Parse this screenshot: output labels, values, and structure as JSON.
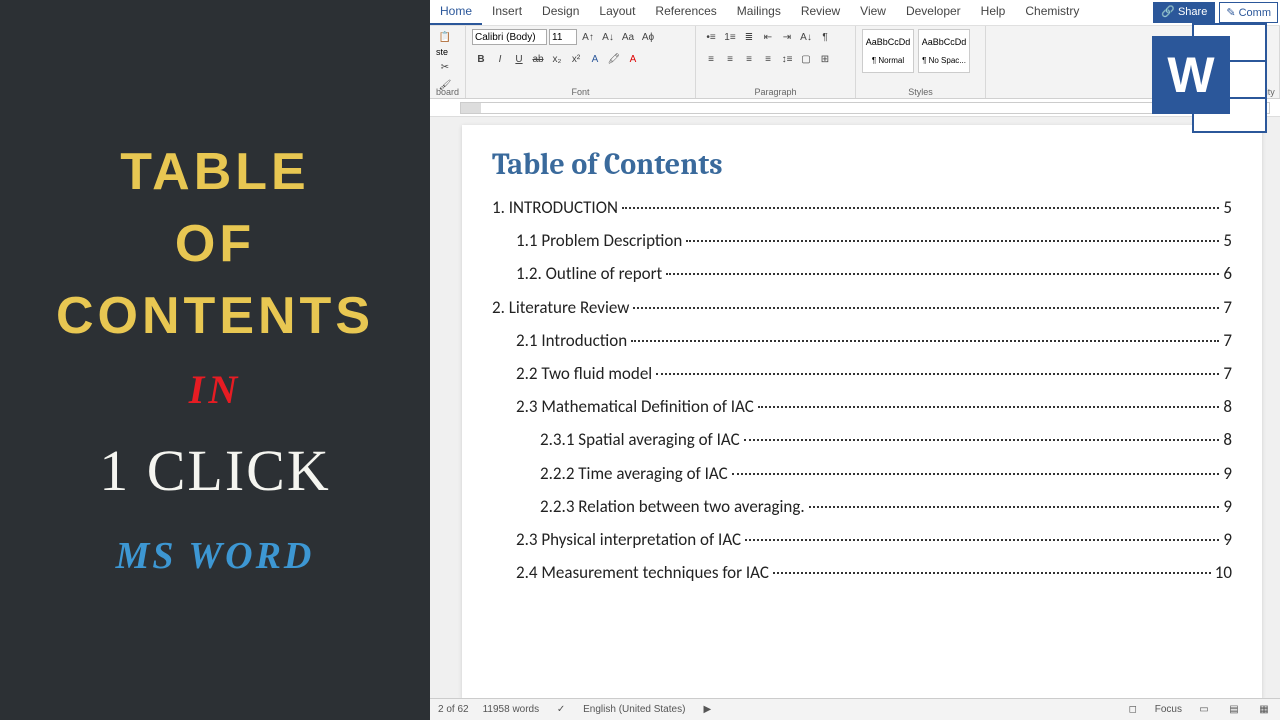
{
  "left_overlay": {
    "line1": "TABLE",
    "line2": "OF",
    "line3": "CONTENTS",
    "line4": "IN",
    "line5": "1 CLICK",
    "line6": "MS WORD"
  },
  "ribbon": {
    "tabs": [
      "Home",
      "Insert",
      "Design",
      "Layout",
      "References",
      "Mailings",
      "Review",
      "View",
      "Developer",
      "Help",
      "Chemistry"
    ],
    "active_tab": "Home",
    "share": "Share",
    "comments": "Comm",
    "font_name": "Calibri (Body)",
    "font_size": "11",
    "groups": {
      "clipboard": "board",
      "font": "Font",
      "paragraph": "Paragraph",
      "styles": "Styles",
      "sensitivity": "Sensitivity"
    },
    "style_items": [
      {
        "preview": "AaBbCcDd",
        "name": "¶ Normal"
      },
      {
        "preview": "AaBbCcDd",
        "name": "¶ No Spac..."
      }
    ],
    "paste": "ste",
    "sensitivity_btn": "ity"
  },
  "toc": {
    "title": "Table of Contents",
    "entries": [
      {
        "level": 1,
        "label": "1.   INTRODUCTION",
        "page": "5"
      },
      {
        "level": 2,
        "label": "1.1 Problem Description ",
        "page": "5"
      },
      {
        "level": 2,
        "label": "1.2. Outline of report ",
        "page": "6"
      },
      {
        "level": 1,
        "label": "2.   Literature Review",
        "page": "7"
      },
      {
        "level": 2,
        "label": "2.1 Introduction ",
        "page": "7"
      },
      {
        "level": 2,
        "label": "2.2 Two fluid model ",
        "page": "7"
      },
      {
        "level": 2,
        "label": "2.3 Mathematical Definition of IAC ",
        "page": "8"
      },
      {
        "level": 3,
        "label": "2.3.1 Spatial averaging of IAC ",
        "page": "8"
      },
      {
        "level": 3,
        "label": "2.2.2 Time averaging of IAC ",
        "page": "9"
      },
      {
        "level": 3,
        "label": "2.2.3 Relation between two averaging. ",
        "page": "9"
      },
      {
        "level": 2,
        "label": "2.3 Physical interpretation of IAC ",
        "page": "9"
      },
      {
        "level": 2,
        "label": "2.4 Measurement techniques for IAC ",
        "page": "10"
      }
    ]
  },
  "statusbar": {
    "page": "2 of 62",
    "words": "11958 words",
    "lang": "English (United States)",
    "focus": "Focus"
  },
  "word_logo": "W"
}
